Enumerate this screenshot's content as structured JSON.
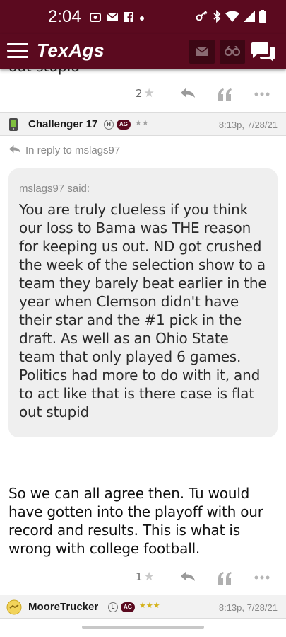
{
  "status_bar": {
    "time": "2:04",
    "left_icons": [
      "camera-icon",
      "mail-icon",
      "facebook-icon",
      "dot-icon"
    ],
    "right_icons": [
      "key-icon",
      "bluetooth-icon",
      "wifi-icon",
      "signal-icon",
      "battery-icon"
    ]
  },
  "app_bar": {
    "logo": "TexAgs",
    "icons": [
      "menu-icon",
      "mail-icon",
      "binoculars-icon",
      "chat-icon"
    ],
    "colors": {
      "brand": "#5b0a1f",
      "brand_dark": "#3c0714"
    }
  },
  "partial_text": "out stupid",
  "post_actions_top": {
    "rating": "2",
    "icons": [
      "star-icon",
      "reply-icon",
      "quote-icon",
      "more-icon"
    ]
  },
  "post": {
    "author": "Challenger 17",
    "badge_h": "H",
    "badge_ag": "AG",
    "stars": "★★",
    "time": "8:13p, 7/28/21",
    "in_reply_to": "In reply to mslags97",
    "quote_author": "mslags97 said:",
    "quote_text": "You are truly clueless if you think our loss to Bama was THE reason for keeping us out. ND got crushed the week of the selection show to a team they barely beat earlier in the year when Clemson didn't have their star and the #1 pick in the draft. As well as an Ohio State team that only played 6 games. Politics had more to do with it, and to act like that is there case is flat out stupid",
    "body": "So we can all agree then. Tu would have gotten into the playoff with our record and results. This is what is wrong with college football.",
    "rating": "1"
  },
  "next_post": {
    "author": "MooreTrucker",
    "badge_l": "L",
    "badge_ag": "AG",
    "stars": "★★★",
    "time": "8:13p, 7/28/21"
  }
}
